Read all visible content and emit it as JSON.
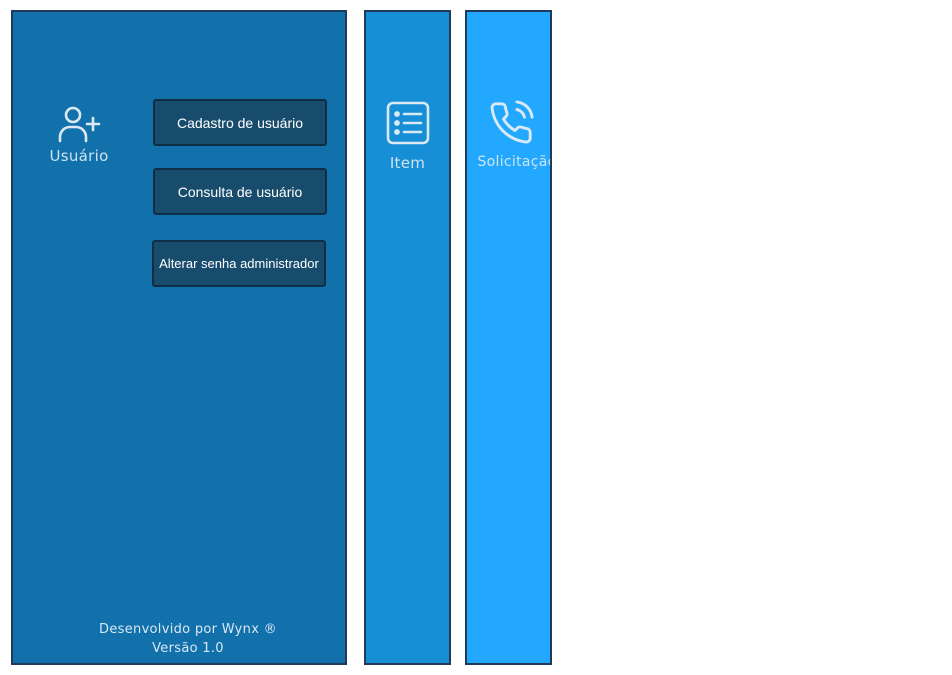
{
  "sidebar": {
    "usuario": {
      "icon": "user-plus-icon",
      "label": "Usuário",
      "submenu": [
        {
          "label": "Cadastro  de usuário"
        },
        {
          "label": "Consulta de usuário"
        },
        {
          "label": "Alterar senha administrador"
        }
      ]
    },
    "item": {
      "icon": "list-icon",
      "label": "Item"
    },
    "solicitacao": {
      "icon": "phone-call-icon",
      "label": "Solicitação"
    },
    "footer": {
      "credit": "Desenvolvido por Wynx ®",
      "version": "Versão 1.0"
    }
  },
  "colors": {
    "panel_usuario": "#1271ab",
    "panel_item": "#168fd6",
    "panel_solicitacao": "#22a9ff",
    "button_bg": "#184c6d",
    "border": "#1f3b57"
  }
}
